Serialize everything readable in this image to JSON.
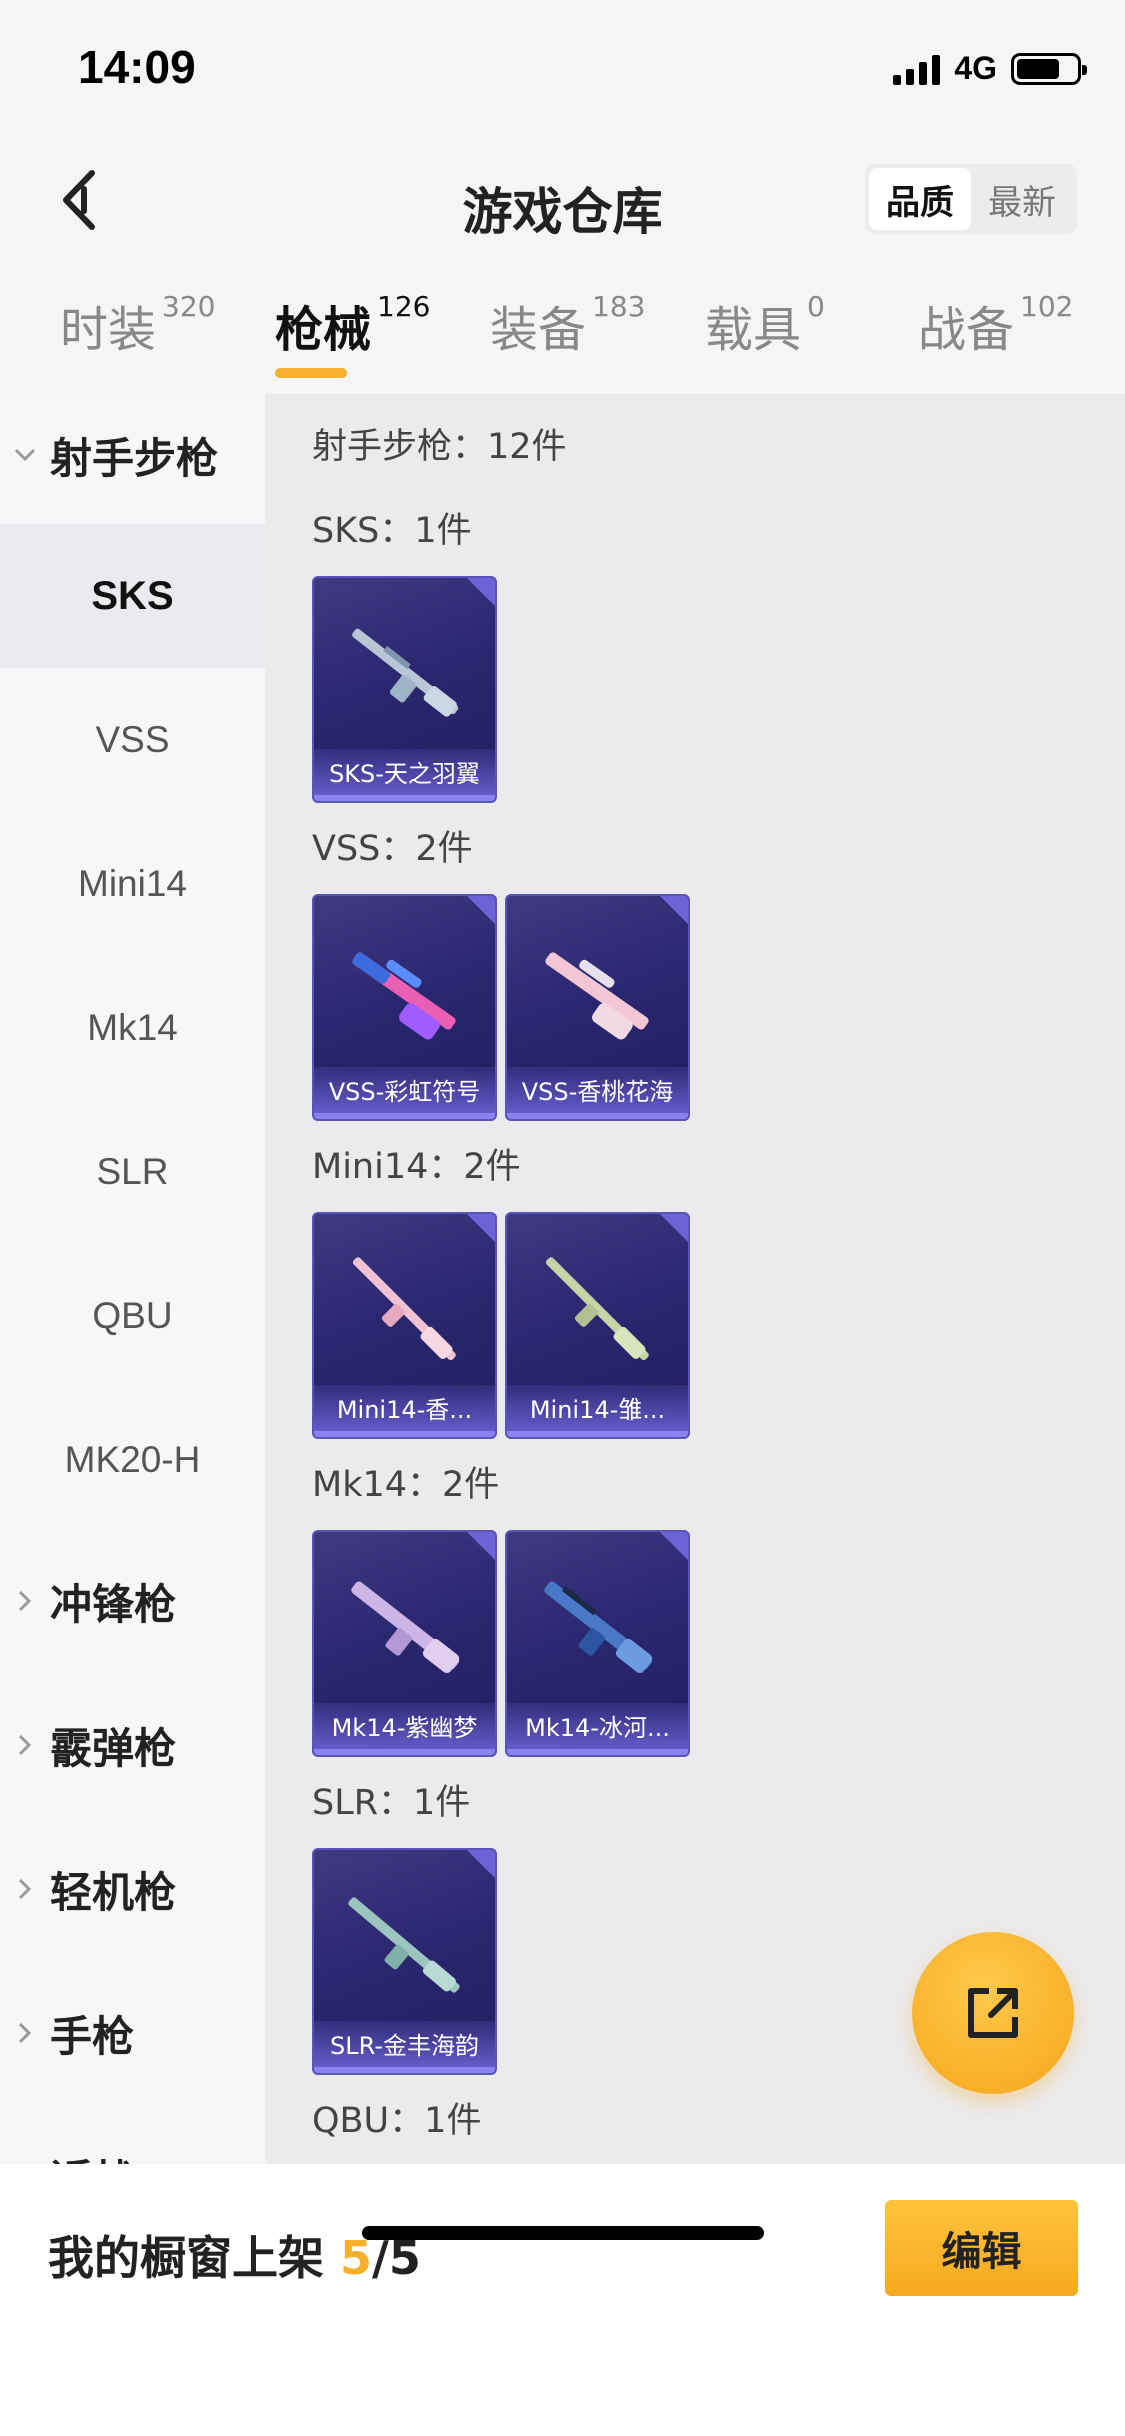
{
  "status": {
    "time": "14:09",
    "network": "4G"
  },
  "header": {
    "title": "游戏仓库",
    "sort": [
      "品质",
      "最新"
    ],
    "sort_active": 0
  },
  "tabs": [
    {
      "label": "时装",
      "count": "320"
    },
    {
      "label": "枪械",
      "count": "126"
    },
    {
      "label": "装备",
      "count": "183"
    },
    {
      "label": "载具",
      "count": "0"
    },
    {
      "label": "战备",
      "count": "102"
    }
  ],
  "sidebar": {
    "groups": [
      "射手步枪",
      "冲锋枪",
      "霰弹枪",
      "轻机枪",
      "手枪",
      "近战"
    ],
    "subs": [
      "SKS",
      "VSS",
      "Mini14",
      "Mk14",
      "SLR",
      "QBU",
      "MK20-H"
    ]
  },
  "content": {
    "summary": "射手步枪：12件",
    "sections": [
      {
        "title": "SKS：1件",
        "items": [
          "SKS-天之羽翼"
        ]
      },
      {
        "title": "VSS：2件",
        "items": [
          "VSS-彩虹符号",
          "VSS-香桃花海"
        ]
      },
      {
        "title": "Mini14：2件",
        "items": [
          "Mini14-香...",
          "Mini14-雏..."
        ]
      },
      {
        "title": "Mk14：2件",
        "items": [
          "Mk14-紫幽梦",
          "Mk14-冰河..."
        ]
      },
      {
        "title": "SLR：1件",
        "items": [
          "SLR-金丰海韵"
        ]
      },
      {
        "title": "QBU：1件",
        "items": []
      }
    ]
  },
  "bottom": {
    "label": "我的橱窗上架",
    "count": "5",
    "total": "/5",
    "edit": "编辑"
  },
  "colors": {
    "accent": "#f6b02e",
    "card_bg": "#2b2770",
    "card_band": "#6a62d4"
  },
  "icons": [
    "back-arrow-icon",
    "share-icon",
    "chevron-down-icon",
    "chevron-right-icon"
  ]
}
